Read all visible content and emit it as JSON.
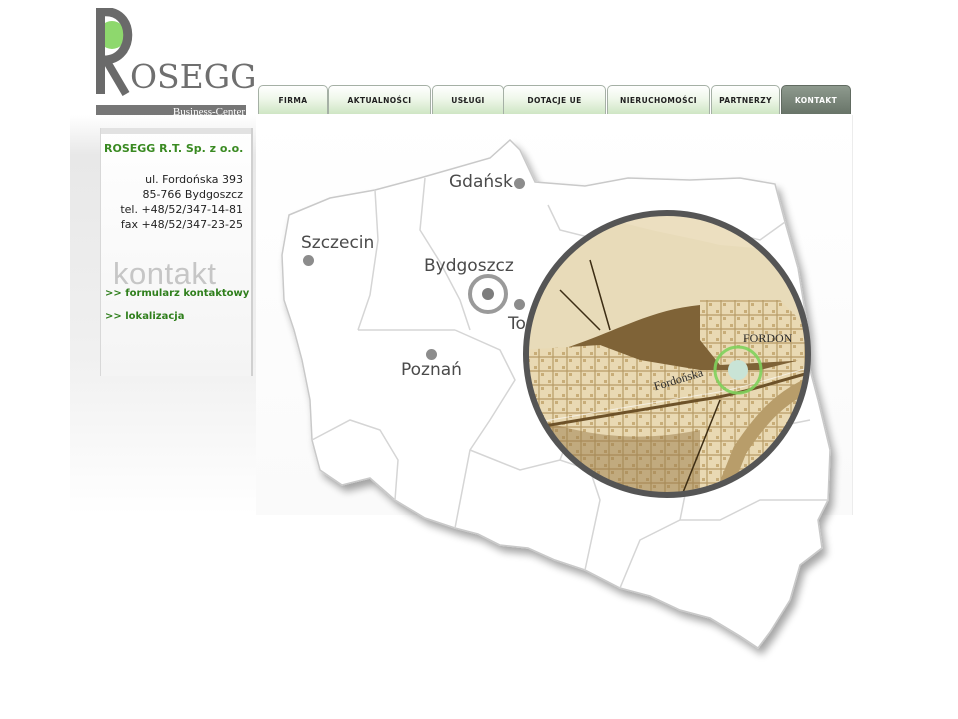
{
  "logo": {
    "subtitle": "Business-Center",
    "brand": "OSEGG",
    "brand_letter": "R"
  },
  "nav": {
    "tabs": [
      {
        "label": "FIRMA",
        "active": false
      },
      {
        "label": "AKTUALNOŚCI",
        "active": false
      },
      {
        "label": "USŁUGI",
        "active": false
      },
      {
        "label": "DOTACJE UE",
        "active": false
      },
      {
        "label": "NIERUCHOMOŚCI",
        "active": false
      },
      {
        "label": "PARTNERZY",
        "active": false
      },
      {
        "label": "KONTAKT",
        "active": true
      }
    ]
  },
  "contact": {
    "company": "ROSEGG R.T. Sp. z o.o.",
    "street": "ul. Fordońska 393",
    "city": "85-766 Bydgoszcz",
    "phone": "tel. +48/52/347-14-81",
    "fax": "fax +48/52/347-23-25",
    "section_word": "kontakt",
    "links": [
      ">> formularz kontaktowy",
      ">> lokalizacja"
    ]
  },
  "map": {
    "cities": [
      "Gdańsk",
      "Szczecin",
      "Bydgoszcz",
      "Poznań",
      "To"
    ],
    "inset_labels": [
      "FORDON",
      "Fordońska"
    ]
  },
  "colors": {
    "accent_green": "#8ed86d",
    "link_green": "#2f7f1c",
    "active_tab": "#6e7a6e",
    "map_brown": "#7a5f35",
    "map_cream": "#e6d5ae"
  }
}
